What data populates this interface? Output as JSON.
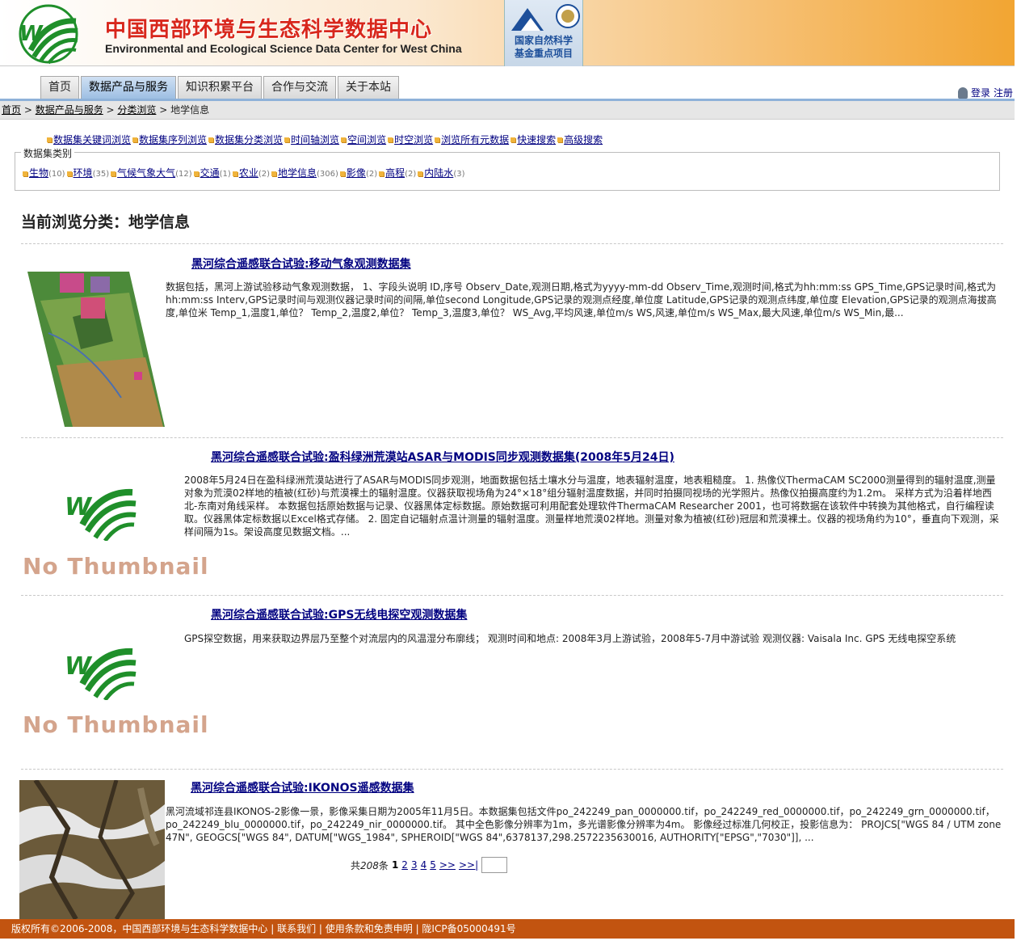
{
  "header": {
    "title_cn": "中国西部环境与生态科学数据中心",
    "title_en": "Environmental and Ecological Science Data Center for West China",
    "nsfc_line1": "国家自然科学",
    "nsfc_line2": "基金重点项目"
  },
  "nav": {
    "tabs": [
      "首页",
      "数据产品与服务",
      "知识积累平台",
      "合作与交流",
      "关于本站"
    ],
    "active": "数据产品与服务",
    "login": "登录",
    "register": "注册"
  },
  "breadcrumb": {
    "home": "首页",
    "sep": " > ",
    "products": "数据产品与服务",
    "browse": "分类浏览",
    "current": "地学信息"
  },
  "browse_links": [
    "数据集关键词浏览",
    "数据集序列浏览",
    "数据集分类浏览",
    "时间轴浏览",
    "空间浏览",
    "时空浏览",
    "浏览所有元数据",
    "快速搜索",
    "高级搜索"
  ],
  "categories": {
    "legend": "数据集类别",
    "items": [
      {
        "name": "生物",
        "count": "(10)"
      },
      {
        "name": "环境",
        "count": "(35)"
      },
      {
        "name": "气候气象大气",
        "count": "(12)"
      },
      {
        "name": "交通",
        "count": "(1)"
      },
      {
        "name": "农业",
        "count": "(2)"
      },
      {
        "name": "地学信息",
        "count": "(306)"
      },
      {
        "name": "影像",
        "count": "(2)"
      },
      {
        "name": "高程",
        "count": "(2)"
      },
      {
        "name": "内陆水",
        "count": "(3)"
      }
    ]
  },
  "current": "当前浏览分类：地学信息",
  "datasets": [
    {
      "title_prefix": "黑河综合遥感联合试验",
      "title_rest": ":移动气象观测数据集",
      "desc": "数据包括，黑河上游试验移动气象观测数据， 1、字段头说明 ID,序号 Observ_Date,观测日期,格式为yyyy-mm-dd Observ_Time,观测时间,格式为hh:mm:ss GPS_Time,GPS记录时间,格式为hh:mm:ss Interv,GPS记录时间与观测仪器记录时间的间隔,单位second Longitude,GPS记录的观测点经度,单位度 Latitude,GPS记录的观测点纬度,单位度 Elevation,GPS记录的观测点海拔高度,单位米 Temp_1,温度1,单位？ Temp_2,温度2,单位？ Temp_3,温度3,单位？ WS_Avg,平均风速,单位m/s WS,风速,单位m/s WS_Max,最大风速,单位m/s WS_Min,最..."
    },
    {
      "title_prefix": "黑河综合遥感联合试验",
      "title_rest": ":盈科绿洲荒漠站ASAR与MODIS同步观测数据集(2008年5月24日)",
      "desc": "2008年5月24日在盈科绿洲荒漠站进行了ASAR与MODIS同步观测，地面数据包括土壤水分与温度，地表辐射温度，地表粗糙度。 1. 热像仪ThermaCAM SC2000测量得到的辐射温度,测量对象为荒漠02样地的植被(红砂)与荒漠裸土的辐射温度。仪器获取视场角为24°×18°组分辐射温度数据，并同时拍摄同视场的光学照片。热像仪拍摄高度约为1.2m。 采样方式为沿着样地西北-东南对角线采样。 本数据包括原始数据与记录、仪器黑体定标数据。原始数据可利用配套处理软件ThermaCAM Researcher 2001，也可将数据在该软件中转换为其他格式，自行编程读取。仪器黑体定标数据以Excel格式存储。 2. 固定自记辐射点温计测量的辐射温度。测量样地荒漠02样地。测量对象为植被(红砂)冠层和荒漠裸土。仪器的视场角约为10°，垂直向下观测，采样间隔为1s。架设高度见数据文档。...",
      "no_thumb": "No Thumbnail"
    },
    {
      "title_prefix": "黑河综合遥感联合试验",
      "title_rest": ":GPS无线电探空观测数据集",
      "desc": "GPS探空数据，用来获取边界层乃至整个对流层内的风温湿分布廓线； 观测时间和地点: 2008年3月上游试验，2008年5-7月中游试验 观测仪器: Vaisala Inc. GPS 无线电探空系统",
      "no_thumb": "No Thumbnail"
    },
    {
      "title_prefix": "黑河综合遥感联合试验",
      "title_rest": ":IKONOS遥感数据集",
      "desc": "黑河流域祁连县IKONOS-2影像一景，影像采集日期为2005年11月5日。本数据集包括文件po_242249_pan_0000000.tif，po_242249_red_0000000.tif，po_242249_grn_0000000.tif，po_242249_blu_0000000.tif，po_242249_nir_0000000.tif。 其中全色影像分辨率为1m，多光谱影像分辨率为4m。 影像经过标准几何校正，投影信息为： PROJCS[\"WGS 84 / UTM zone 47N\", GEOGCS[\"WGS 84\", DATUM[\"WGS_1984\", SPHEROID[\"WGS 84\",6378137,298.2572235630016, AUTHORITY[\"EPSG\",\"7030\"]], ..."
    }
  ],
  "pager": {
    "total_prefix": "共",
    "total": "208",
    "total_suffix": "条",
    "current": "1",
    "pages": [
      "2",
      "3",
      "4",
      "5"
    ],
    "next": ">>",
    "last": ">>|"
  },
  "footer": "版权所有©2006-2008，中国西部环境与生态科学数据中心 | 联系我们 | 使用条款和免责申明 | 陇ICP备05000491号",
  "colors": {
    "accent": "#000080",
    "footer": "#c25410",
    "brand_red": "#d8271c",
    "brand_green": "#2a9a2a"
  }
}
